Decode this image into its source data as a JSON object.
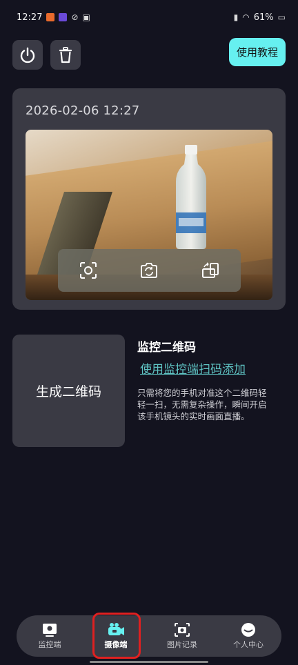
{
  "status_bar": {
    "time": "12:27",
    "battery": "61%",
    "badge_colors": [
      "#e86a2c",
      "#6a4ad8"
    ]
  },
  "top": {
    "power_icon": "power-icon",
    "delete_icon": "trash-icon",
    "tutorial_label": "使用教程"
  },
  "camera_card": {
    "datetime": "2026-02-06 12:27",
    "controls": [
      "scan-frame-icon",
      "switch-camera-icon",
      "rotate-screen-icon"
    ]
  },
  "qr": {
    "generate_label": "生成二维码",
    "title": "监控二维码",
    "link": "使用监控端扫码添加",
    "description": "只需将您的手机对准这个二维码轻轻一扫，无需复杂操作，瞬间开启该手机镜头的实时画面直播。"
  },
  "nav": {
    "items": [
      {
        "label": "监控端",
        "icon": "monitor-icon"
      },
      {
        "label": "摄像端",
        "icon": "camera-device-icon",
        "active": true
      },
      {
        "label": "图片记录",
        "icon": "photo-record-icon"
      },
      {
        "label": "个人中心",
        "icon": "profile-icon"
      }
    ]
  },
  "colors": {
    "background": "#13131f",
    "card": "#3a3a44",
    "accent": "#66f0f0",
    "link": "#5fc4c4",
    "highlight": "#e02020"
  }
}
